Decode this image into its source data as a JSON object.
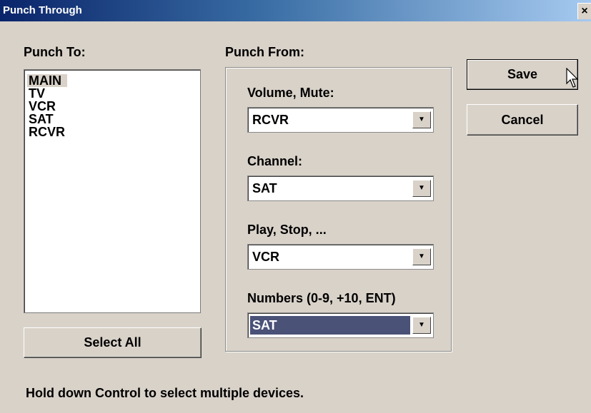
{
  "window": {
    "title": "Punch Through",
    "close_glyph": "×"
  },
  "punch_to": {
    "label": "Punch To:",
    "devices": [
      "MAIN",
      "TV",
      "VCR",
      "SAT",
      "RCVR"
    ],
    "selected": "MAIN",
    "select_all_label": "Select All"
  },
  "punch_from": {
    "label": "Punch From:",
    "volume": {
      "label": "Volume, Mute:",
      "value": "RCVR"
    },
    "channel": {
      "label": "Channel:",
      "value": "SAT"
    },
    "play": {
      "label": "Play, Stop, ...",
      "value": "VCR"
    },
    "numbers": {
      "label": "Numbers (0-9, +10, ENT)",
      "value": "SAT"
    }
  },
  "buttons": {
    "save": "Save",
    "cancel": "Cancel"
  },
  "hint": "Hold down Control to select multiple devices.",
  "icons": {
    "dropdown": "chevron-down-icon",
    "cursor": "arrow-pointer-icon"
  },
  "colors": {
    "selection": "#4a5278",
    "face": "#d9d2c9"
  }
}
